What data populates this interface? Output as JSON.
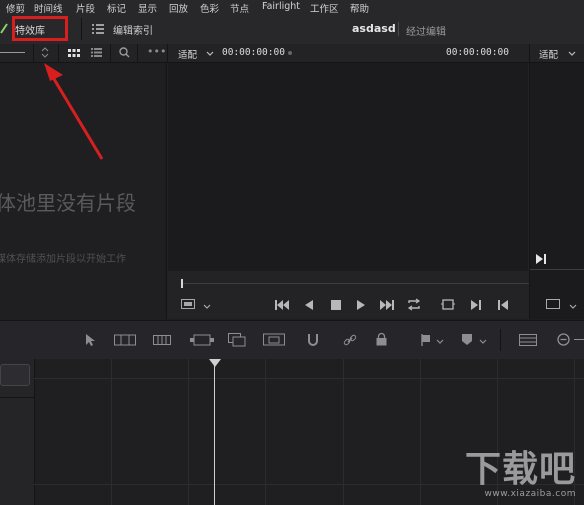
{
  "menu": {
    "items": [
      "修剪",
      "时间线",
      "片段",
      "标记",
      "显示",
      "回放",
      "色彩",
      "节点",
      "Fairlight",
      "工作区",
      "帮助"
    ]
  },
  "toolbar": {
    "effects_label": "特效库",
    "edit_index_label": "编辑索引",
    "project_name": "asdasd",
    "mode_label": "经过编辑",
    "highlight_color": "#d71f1f"
  },
  "subbar": {
    "fit_label_left": "适配",
    "timecode_left": "00:00:00:00",
    "timecode_right": "00:00:00:00",
    "fit_label_right": "适配"
  },
  "media_pool": {
    "empty_title": "体池里没有片段",
    "empty_hint": "媒体存储添加片段以开始工作"
  },
  "watermark": {
    "text": "下载吧",
    "url": "www.xiazaiba.com"
  },
  "icons": {
    "menu_shortcut": "pencil-icon",
    "list": "list-icon",
    "grid": "grid-view-icon",
    "search": "search-icon",
    "more": "more-dots-icon",
    "sort": "sort-arrows-icon",
    "annotation_arrow": "red-arrow-icon",
    "play": "play-icon"
  },
  "colors": {
    "background": "#1e1e21",
    "panel": "#28282b",
    "accent_red": "#d71f1f"
  }
}
